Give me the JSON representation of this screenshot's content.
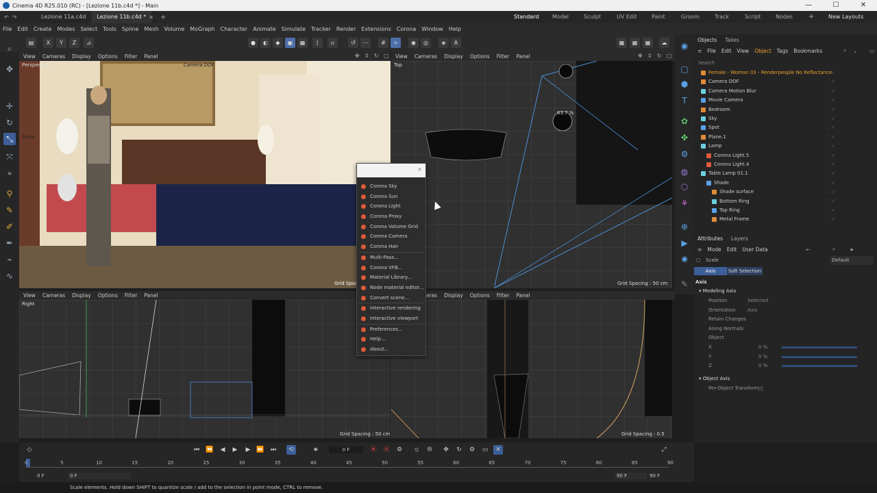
{
  "window": {
    "title": "Cinema 4D R25.010 (RC) - [Lezione 11b.c4d *] - Main",
    "controls": [
      "—",
      "☐",
      "✕"
    ]
  },
  "tabs": {
    "items": [
      "Lezione 11a.c4d",
      "Lezione 11b.c4d *"
    ],
    "layouts": [
      "Standard",
      "Model",
      "Sculpt",
      "UV Edit",
      "Paint",
      "Groom",
      "Track",
      "Script",
      "Nodes"
    ],
    "new_layouts": "New Layouts"
  },
  "menubar": [
    "File",
    "Edit",
    "Create",
    "Modes",
    "Select",
    "Tools",
    "Spline",
    "Mesh",
    "Volume",
    "MoGraph",
    "Character",
    "Animate",
    "Simulate",
    "Tracker",
    "Render",
    "Extensions",
    "Corona",
    "Window",
    "Help"
  ],
  "toolbar": {
    "axes": [
      "X",
      "Y",
      "Z"
    ]
  },
  "viewport_menu": [
    "View",
    "Cameras",
    "Display",
    "Options",
    "Filter",
    "Panel"
  ],
  "viewports": {
    "perspective": {
      "label": "Perspective",
      "camera": "Camera DOF",
      "grid": "Grid Spacing : 50 cm",
      "scale_label": "Scale"
    },
    "top": {
      "label": "Top",
      "grid": "Grid Spacing : 50 cm",
      "measure": "63.7 %"
    },
    "right": {
      "label": "Right",
      "grid": "Grid Spacing : 50 cm"
    },
    "front": {
      "label": "Front",
      "grid": "Grid Spacing : 0.5 cm"
    }
  },
  "corona_menu": {
    "groups": [
      [
        {
          "label": "Corona Sky",
          "color": "#e05a3a"
        },
        {
          "label": "Corona Sun",
          "color": "#e05a3a"
        },
        {
          "label": "Corona Light",
          "color": "#e05a3a"
        },
        {
          "label": "Corona Proxy",
          "color": "#e05a3a"
        },
        {
          "label": "Corona Volume Grid",
          "color": "#e05a3a"
        },
        {
          "label": "Corona Camera",
          "color": "#e05a3a"
        },
        {
          "label": "Corona Hair",
          "color": "#e05a3a"
        }
      ],
      [
        {
          "label": "Multi-Pass...",
          "color": "#e05a3a"
        },
        {
          "label": "Corona VFB...",
          "color": "#e05a3a"
        },
        {
          "label": "Material Library...",
          "color": "#e05a3a"
        },
        {
          "label": "Node material editor...",
          "color": "#e05a3a"
        },
        {
          "label": "Convert scene...",
          "color": "#e05a3a"
        }
      ],
      [
        {
          "label": "Interactive rendering",
          "color": "#e05a3a"
        },
        {
          "label": "Interactive viewport",
          "color": "#e05a3a"
        }
      ],
      [
        {
          "label": "Preferences...",
          "color": "#e05a3a"
        },
        {
          "label": "Help...",
          "color": "#e05a3a"
        },
        {
          "label": "About...",
          "color": "#e05a3a"
        }
      ]
    ]
  },
  "objects": {
    "tabs": [
      "Objects",
      "Takes"
    ],
    "menu": [
      "File",
      "Edit",
      "View",
      "Object",
      "Tags",
      "Bookmarks"
    ],
    "search": "Search",
    "rows": [
      {
        "label": "Female - Woman 03 - Renderpeople No Reflectance",
        "indent": 0,
        "selected": true
      },
      {
        "label": "Camera DOF",
        "indent": 0
      },
      {
        "label": "Camera Motion Blur",
        "indent": 0
      },
      {
        "label": "Movie Camera",
        "indent": 0
      },
      {
        "label": "Bedroom",
        "indent": 0
      },
      {
        "label": "Sky",
        "indent": 0
      },
      {
        "label": "Spot",
        "indent": 0
      },
      {
        "label": "Plane.1",
        "indent": 0
      },
      {
        "label": "Lamp",
        "indent": 0
      },
      {
        "label": "Corona Light.5",
        "indent": 1
      },
      {
        "label": "Corona Light.4",
        "indent": 1
      },
      {
        "label": "Table Lamp 01.1",
        "indent": 0
      },
      {
        "label": "Shade",
        "indent": 1
      },
      {
        "label": "Shade surface",
        "indent": 2
      },
      {
        "label": "Bottom Ring",
        "indent": 2
      },
      {
        "label": "Top Ring",
        "indent": 2
      },
      {
        "label": "Metal Frame",
        "indent": 2
      }
    ]
  },
  "attributes": {
    "tabs": [
      "Attributes",
      "Layers"
    ],
    "menu": [
      "Mode",
      "Edit",
      "User Data"
    ],
    "tool": "Scale",
    "preset": "Default",
    "subtabs": [
      "Axis",
      "Soft Selection"
    ],
    "section": "Axis",
    "modeling_axis": "Modeling Axis",
    "fields": [
      {
        "k": "Position",
        "v": "Selected"
      },
      {
        "k": "Orientation",
        "v": "Axis"
      },
      {
        "k": "Retain Changes",
        "v": ""
      },
      {
        "k": "Along Normals",
        "v": ""
      },
      {
        "k": "Object",
        "v": ""
      },
      {
        "k": "X",
        "v": "0 %"
      },
      {
        "k": "Y",
        "v": "0 %"
      },
      {
        "k": "Z",
        "v": "0 %"
      }
    ],
    "object_axis": "Object Axis",
    "per_object": "Per-Object Transform"
  },
  "timeline": {
    "current": "0 F",
    "ticks": [
      "0",
      "5",
      "10",
      "15",
      "20",
      "25",
      "30",
      "35",
      "40",
      "45",
      "50",
      "55",
      "60",
      "65",
      "70",
      "75",
      "80",
      "85",
      "90"
    ],
    "start": "0 F",
    "start2": "0 F",
    "end": "90 F",
    "end2": "90 F"
  },
  "status": "Scale elements. Hold down SHIFT to quantize scale / add to the selection in point mode, CTRL to remove."
}
